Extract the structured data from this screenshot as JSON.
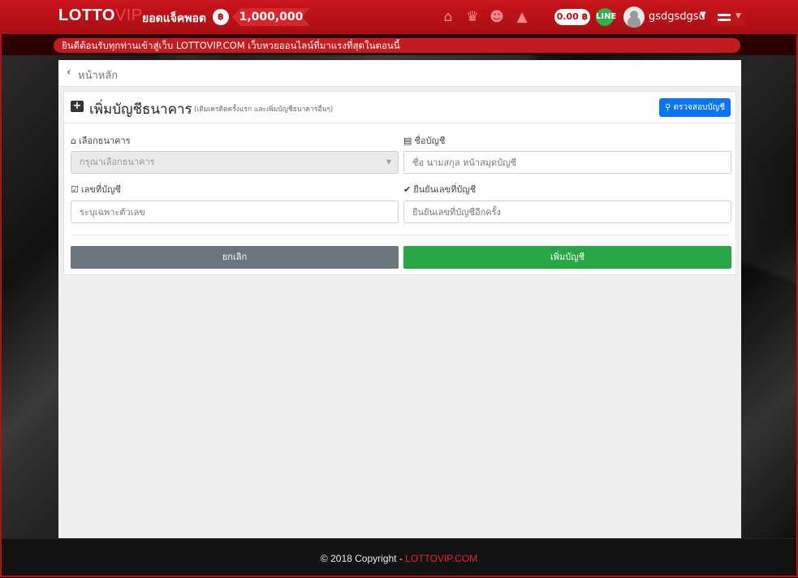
{
  "navbar": {
    "logo_main": "LOTTO",
    "logo_accent": "VIP",
    "jackpot_label": "ยอดแจ็คพอต",
    "jackpot_value": "1,000,000",
    "credit": "0.00 ฿",
    "username": "gsdgsdgsd",
    "icons": [
      "home-icon",
      "trophy-icon",
      "users-icon",
      "bell-icon",
      "line-chat-icon",
      "menu-icon"
    ]
  },
  "marquee": {
    "text": "ยินดีต้อนรับทุกท่านเข้าสู่เว็บ LOTTOVIP.COM เว็บหวยออนไลน์ที่มาแรงที่สุดในตอนนี้"
  },
  "breadcrumb": {
    "back_label": "หน้าหลัก"
  },
  "form": {
    "title": "เพิ่มบัญชีธนาคาร",
    "subtitle": "(เติมเครดิตครั้งแรก และเพิ่มบัญชีธนาคารอื่นๆ)",
    "check_button": "ตรวจสอบบัญชี",
    "bank_label": "เลือกธนาคาร",
    "bank_placeholder": "กรุณาเลือกธนาคาร",
    "account_name_label": "ชื่อบัญชี",
    "account_name_placeholder": "ชื่อ นามสกุล หน้าสมุดบัญชี",
    "account_no_label": "เลขที่บัญชี",
    "account_no_placeholder": "ระบุเฉพาะตัวเลข",
    "confirm_label": "ยืนยันเลขที่บัญชี",
    "confirm_placeholder": "ยืนยันเลขที่บัญชีอีกครั้ง",
    "cancel_button": "ยกเลิก",
    "submit_button": "เพิ่มบัญชี"
  },
  "footer": {
    "copyright": "© 2018 Copyright - ",
    "brand": "LOTTOVIP.COM"
  },
  "colors": {
    "brand_red": "#c9141b",
    "primary": "#0a75f0",
    "success": "#28a745",
    "secondary": "#6c757d"
  }
}
